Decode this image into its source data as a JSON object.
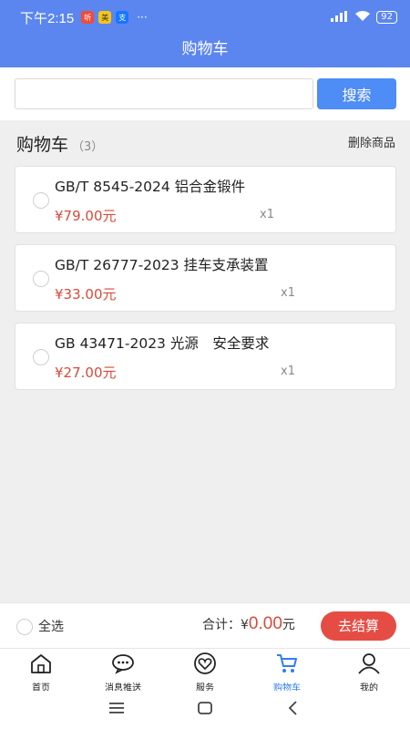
{
  "status": {
    "time": "下午2:15",
    "battery": "92"
  },
  "header": {
    "title": "购物车"
  },
  "search": {
    "value": "",
    "placeholder": "",
    "button_label": "搜索"
  },
  "cart": {
    "title": "购物车",
    "count": "（3）",
    "delete_label": "删除商品",
    "items": [
      {
        "name": "GB/T 8545-2024 铝合金锻件",
        "price": "¥79.00元",
        "qty": "x1"
      },
      {
        "name": "GB/T 26777-2023 挂车支承装置",
        "price": "¥33.00元",
        "qty": "x1"
      },
      {
        "name": "GB 43471-2023 光源　安全要求",
        "price": "¥27.00元",
        "qty": "x1"
      }
    ]
  },
  "footer": {
    "select_all": "全选",
    "total_label": "合计：",
    "total_currency": "¥",
    "total_value": "0.00",
    "total_unit": "元",
    "checkout_label": "去结算"
  },
  "tabs": [
    {
      "label": "首页",
      "icon": "home-icon"
    },
    {
      "label": "消息推送",
      "icon": "message-icon"
    },
    {
      "label": "服务",
      "icon": "heart-icon"
    },
    {
      "label": "购物车",
      "icon": "cart-icon",
      "active": true
    },
    {
      "label": "我的",
      "icon": "user-icon"
    }
  ],
  "colors": {
    "primary": "#5b86f0",
    "search_button": "#4e8cf6",
    "price": "#d94a3a",
    "checkout": "#e54d44",
    "active_tab": "#2f7ef0"
  }
}
